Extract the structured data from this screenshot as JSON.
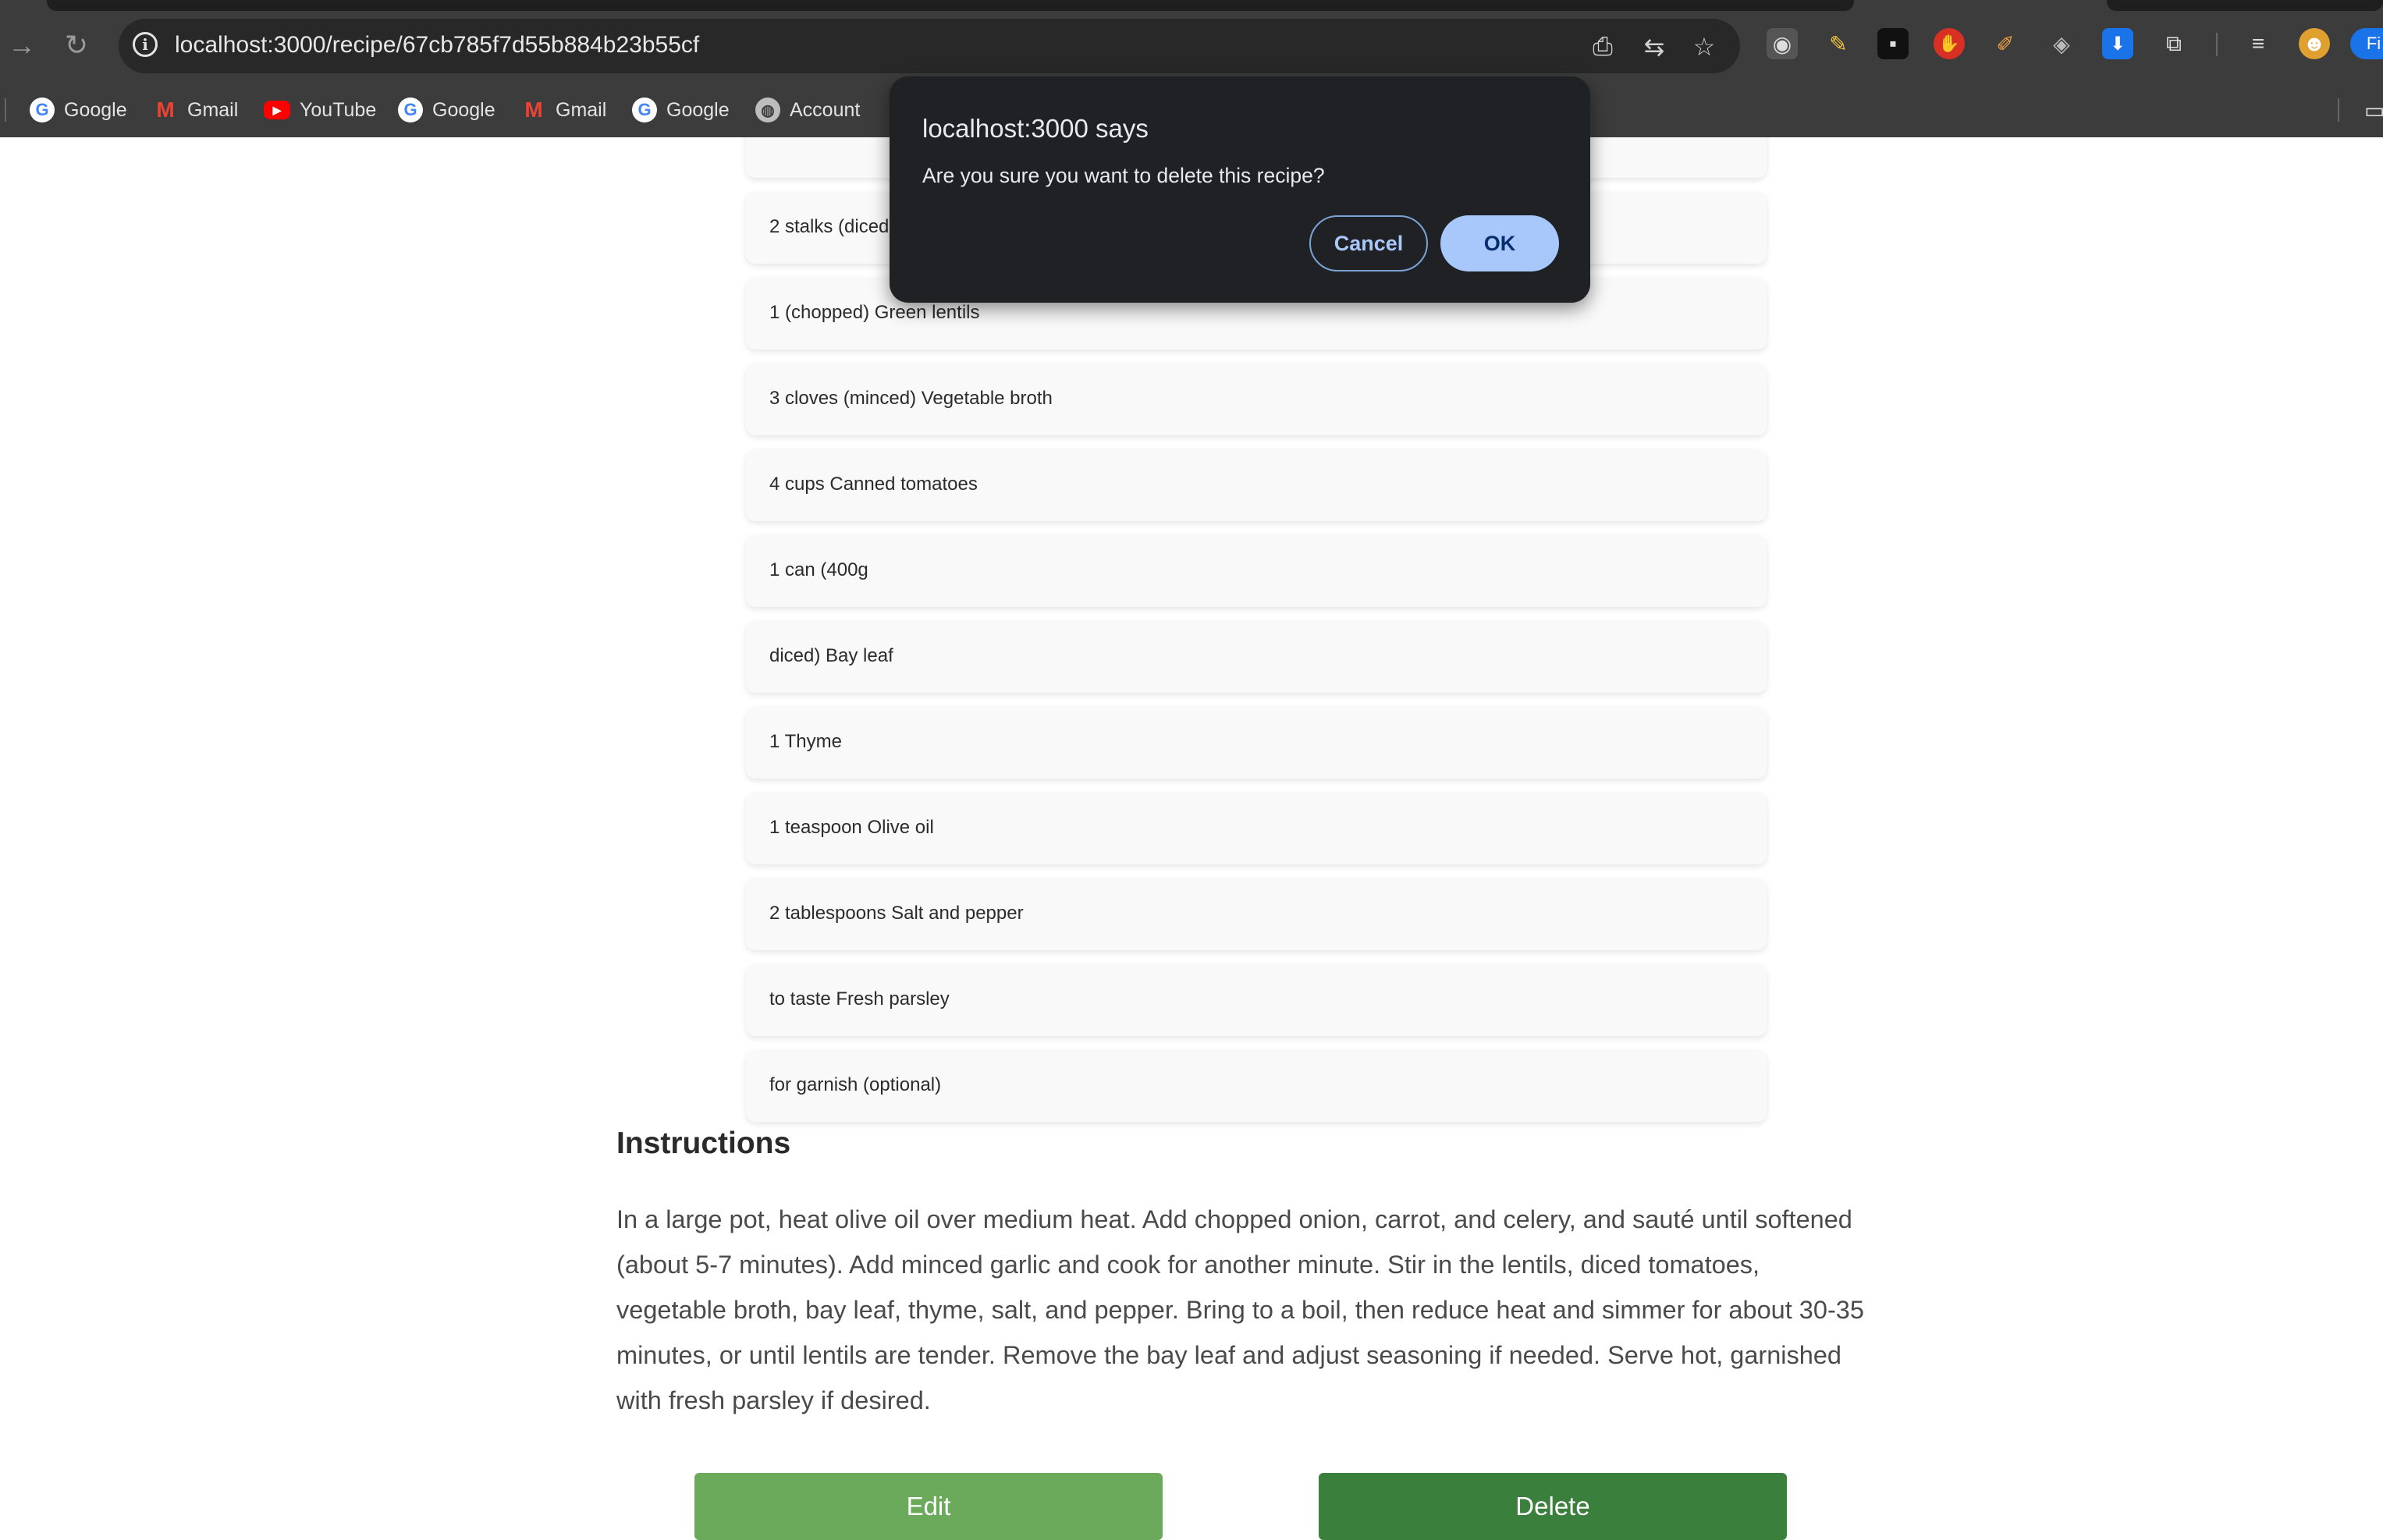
{
  "browser": {
    "url": "localhost:3000/recipe/67cb785f7d55b884b23b55cf",
    "profile_initial": "Fi",
    "bookmarks": [
      {
        "label": "Google",
        "icon": "google-icon"
      },
      {
        "label": "Gmail",
        "icon": "gmail-icon"
      },
      {
        "label": "YouTube",
        "icon": "youtube-icon"
      },
      {
        "label": "Google",
        "icon": "google-icon"
      },
      {
        "label": "Gmail",
        "icon": "gmail-icon"
      },
      {
        "label": "Google",
        "icon": "google-icon"
      },
      {
        "label": "Account",
        "icon": "globe-icon"
      }
    ]
  },
  "dialog": {
    "title": "localhost:3000 says",
    "message": "Are you sure you want to delete this recipe?",
    "cancel_label": "Cancel",
    "ok_label": "OK"
  },
  "recipe": {
    "ingredients": [
      "",
      "2 stalks (diced) Garlic",
      "1 (chopped) Green lentils",
      "3 cloves (minced) Vegetable broth",
      "4 cups Canned tomatoes",
      "1 can (400g",
      "diced) Bay leaf",
      "1 Thyme",
      "1 teaspoon Olive oil",
      "2 tablespoons Salt and pepper",
      "to taste Fresh parsley",
      "for garnish (optional)"
    ],
    "instructions_heading": "Instructions",
    "instructions": "In a large pot, heat olive oil over medium heat. Add chopped onion, carrot, and celery, and sauté until softened (about 5-7 minutes). Add minced garlic and cook for another minute. Stir in the lentils, diced tomatoes, vegetable broth, bay leaf, thyme, salt, and pepper. Bring to a boil, then reduce heat and simmer for about 30-35 minutes, or until lentils are tender. Remove the bay leaf and adjust seasoning if needed. Serve hot, garnished with fresh parsley if desired.",
    "edit_label": "Edit",
    "delete_label": "Delete"
  },
  "colors": {
    "edit_button": "#6aaa5a",
    "delete_button": "#3a7f3c",
    "dialog_bg": "#202124",
    "ok_button": "#a8c7fa"
  }
}
